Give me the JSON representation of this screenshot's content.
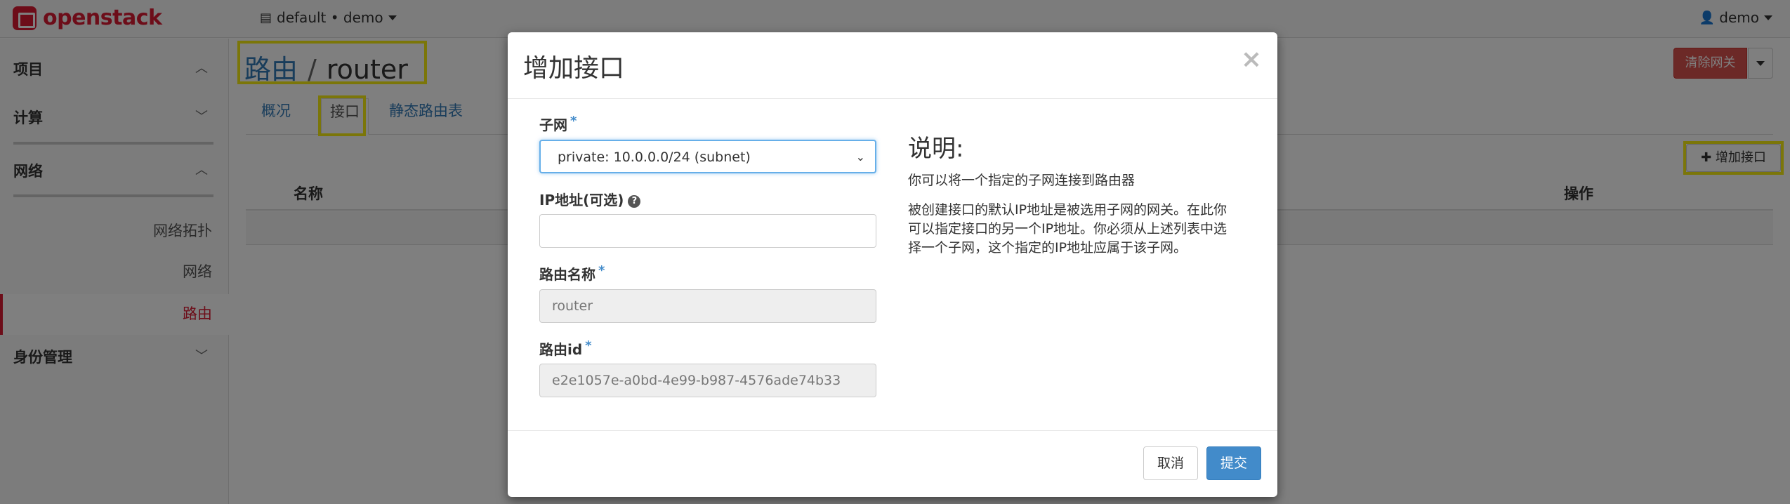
{
  "navbar": {
    "brand": "openstack",
    "project_selector": "default • demo",
    "user_menu": "demo"
  },
  "sidebar": {
    "sections": [
      {
        "label": "项目",
        "expanded": true
      },
      {
        "label": "计算",
        "expanded": false
      },
      {
        "label": "网络",
        "expanded": true
      },
      {
        "label": "身份管理",
        "expanded": false
      }
    ],
    "network_items": [
      {
        "label": "网络拓扑"
      },
      {
        "label": "网络"
      },
      {
        "label": "路由",
        "active": true
      }
    ]
  },
  "page": {
    "breadcrumb_parent": "路由",
    "separator": "/",
    "title": "router",
    "tabs": [
      "概况",
      "接口",
      "静态路由表"
    ],
    "active_tab": "接口",
    "clear_gateway_label": "清除网关",
    "add_interface_label": "增加接口",
    "table_headers": [
      "名称",
      "操作"
    ]
  },
  "modal": {
    "title": "增加接口",
    "close_symbol": "×",
    "subnet_label": "子网",
    "subnet_value": "private: 10.0.0.0/24 (subnet)",
    "ip_label": "IP地址(可选)",
    "ip_value": "",
    "router_name_label": "路由名称",
    "router_name_value": "router",
    "router_id_label": "路由id",
    "router_id_value": "e2e1057e-a0bd-4e99-b987-4576ade74b33",
    "required_mark": "*",
    "help_icon_glyph": "?",
    "description_title": "说明:",
    "description_line1": "你可以将一个指定的子网连接到路由器",
    "description_line2": "被创建接口的默认IP地址是被选用子网的网关。在此你",
    "description_line3": "可以指定接口的另一个IP地址。你必须从上述列表中选",
    "description_line4": "择一个子网，这个指定的IP地址应属于该子网。",
    "cancel_label": "取消",
    "submit_label": "提交"
  },
  "colors": {
    "brand_red": "#da1a32",
    "link_blue": "#337ab7",
    "primary_button": "#428bca",
    "danger_button": "#d9534f",
    "highlight_yellow": "#f7ec12"
  }
}
